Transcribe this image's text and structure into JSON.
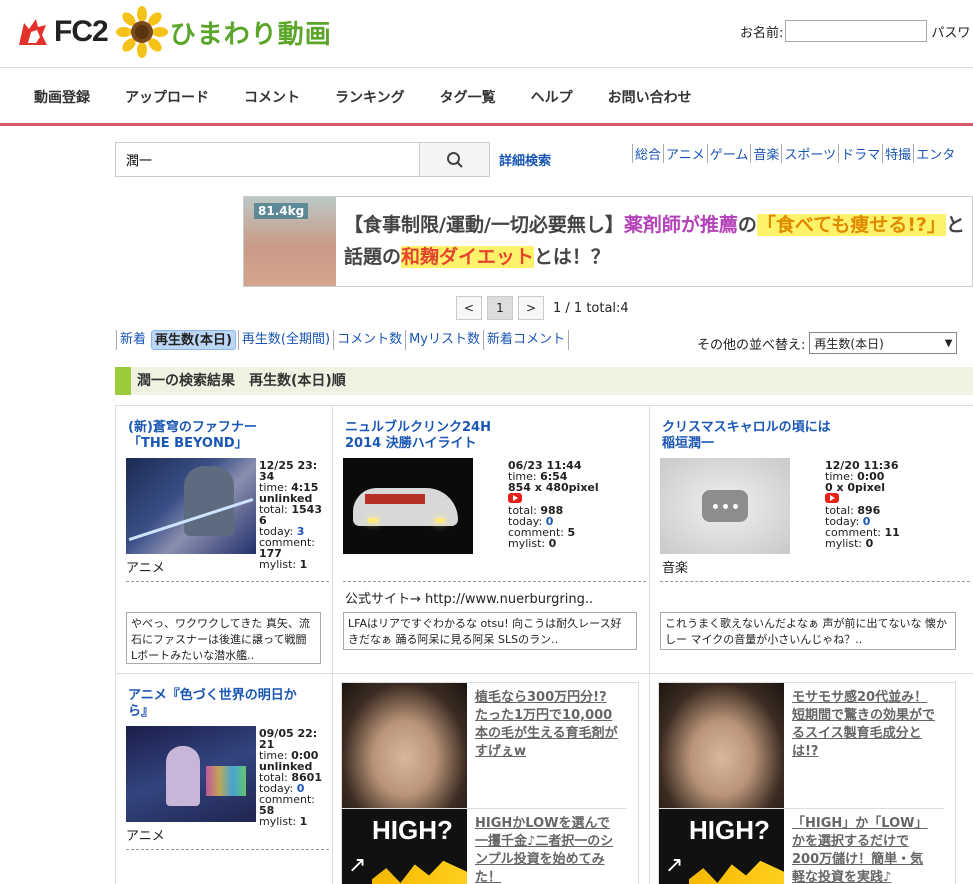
{
  "header": {
    "logo_fc2": "FC2",
    "logo_himawari": "ひまわり動画",
    "login_name_label": "お名前:",
    "login_pass_label": "パスワ"
  },
  "nav": [
    "動画登録",
    "アップロード",
    "コメント",
    "ランキング",
    "タグ一覧",
    "ヘルプ",
    "お問い合わせ"
  ],
  "search": {
    "query": "潤一",
    "advanced": "詳細検索",
    "categories": [
      "総合",
      "アニメ",
      "ゲーム",
      "音楽",
      "スポーツ",
      "ドラマ",
      "特撮",
      "エンタ"
    ]
  },
  "ad_banner": {
    "weight": "81.4kg",
    "p1": "【食事制限/運動/一切必要無し】",
    "p2": "薬剤師が推薦",
    "p3": "の",
    "p4": "「食べても痩せる!?」",
    "p5": "と話題の",
    "p6": "和麹ダイエット",
    "p7": "とは！？"
  },
  "pager": {
    "prev": "<",
    "current": "1",
    "next": ">",
    "info": "1 / 1 total:4"
  },
  "sort": {
    "tabs": [
      "新着",
      "再生数(本日)",
      "再生数(全期間)",
      "コメント数",
      "Myリスト数",
      "新着コメント"
    ],
    "active_index": 1,
    "other_label": "その他の並べ替え:",
    "selected": "再生数(本日)"
  },
  "results_heading": "潤一の検索結果　再生数(本日)順",
  "videos": [
    {
      "title_l1": "(新)蒼穹のファフナー",
      "title_l2": "「THE BEYOND」",
      "date_l1": "12/25 23:",
      "date_l2": "34",
      "time_label": "time: ",
      "time": "4:15",
      "status": "unlinked",
      "total_label": "total: ",
      "total_l1": "1543",
      "total_l2": "6",
      "today_label": "today: ",
      "today": "3",
      "comment_label": "comment:",
      "comment": "177",
      "mylist_label": "mylist: ",
      "mylist": "1",
      "category": "アニメ",
      "comment_text": "やべっ、ワクワクしてきた 真矢、流石にファスナーは後進に譲って戦闘 Lボートみたいな潜水艦.."
    },
    {
      "title_l1": "ニュルブルクリンク24H",
      "title_l2": "2014 決勝ハイライト",
      "date": "06/23 11:44",
      "time_label": "time: ",
      "time": "6:54",
      "pixel": "854 x 480pixel",
      "total_label": "total: ",
      "total": "988",
      "today_label": "today: ",
      "today": "0",
      "comment_label": "comment: ",
      "comment": "5",
      "mylist_label": "mylist: ",
      "mylist": "0",
      "description": "公式サイト→ http://www.nuerburgring..",
      "comment_text": "LFAはリアですぐわかるな otsu! 向こうは耐久レース好きだなぁ 踊る阿呆に見る阿呆 SLSのラン.."
    },
    {
      "title_l1": "クリスマスキャロルの頃には",
      "title_l2": "稲垣潤一",
      "date": "12/20 11:36",
      "time_label": "time: ",
      "time": "0:00",
      "pixel": "0 x 0pixel",
      "total_label": "total: ",
      "total": "896",
      "today_label": "today: ",
      "today": "0",
      "comment_label": "comment: ",
      "comment": "11",
      "mylist_label": "mylist: ",
      "mylist": "0",
      "category": "音楽",
      "comment_text": "これうまく歌えないんだよなぁ 声が前に出てないな 懐かしー マイクの音量が小さいんじゃね？.."
    },
    {
      "title_l1": "アニメ『色づく世界の明日か",
      "title_l2": "ら』",
      "date_l1": "09/05 22:",
      "date_l2": "21",
      "time_label": "time: ",
      "time": "0:00",
      "status": "unlinked",
      "total_label": "total: ",
      "total": "8601",
      "today_label": "today: ",
      "today": "0",
      "comment_label": "comment:",
      "comment": "58",
      "mylist_label": "mylist: ",
      "mylist": "1",
      "category": "アニメ"
    }
  ],
  "ads": [
    {
      "link1": "植毛なら300万円分!?たった1万円で10,000本の毛が生える育毛剤がすげぇw",
      "pic2_text": "HIGH?",
      "link2": "HIGHかLOWを選んで一攫千金♪二者択一のシンプル投資を始めてみた！"
    },
    {
      "link1": "モサモサ感20代並み！短期間で驚きの効果がでるスイス製育毛成分とは!?",
      "pic2_text": "HIGH?",
      "link2": "「HIGH」か「LOW」かを選択するだけで200万儲け！簡単・気軽な投資を実践♪"
    }
  ],
  "colors": {
    "accent_red": "#d9566b",
    "link_blue": "#1a56b4",
    "green_bar": "#9bcb3b"
  }
}
